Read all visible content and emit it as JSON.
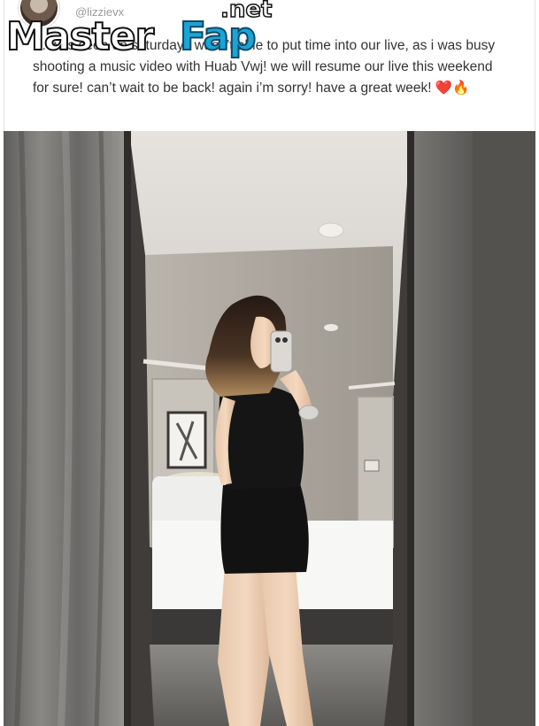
{
  "post": {
    "handle": "@lizzievx",
    "text": "… was seen on saturday i wasn’t able to put time into our live, as i was busy shooting a music video with Huab Vwj! we will resume our live this weekend for sure! can’t wait to be back! again i’m sorry! have a great week! ❤️🔥"
  },
  "watermark": {
    "brand_part1": "Master",
    "brand_part2": "Fap",
    "brand_suffix": ".net"
  },
  "colors": {
    "watermark_accent": "#1aa4d8",
    "text": "#333333",
    "handle": "#9a9a9a"
  }
}
